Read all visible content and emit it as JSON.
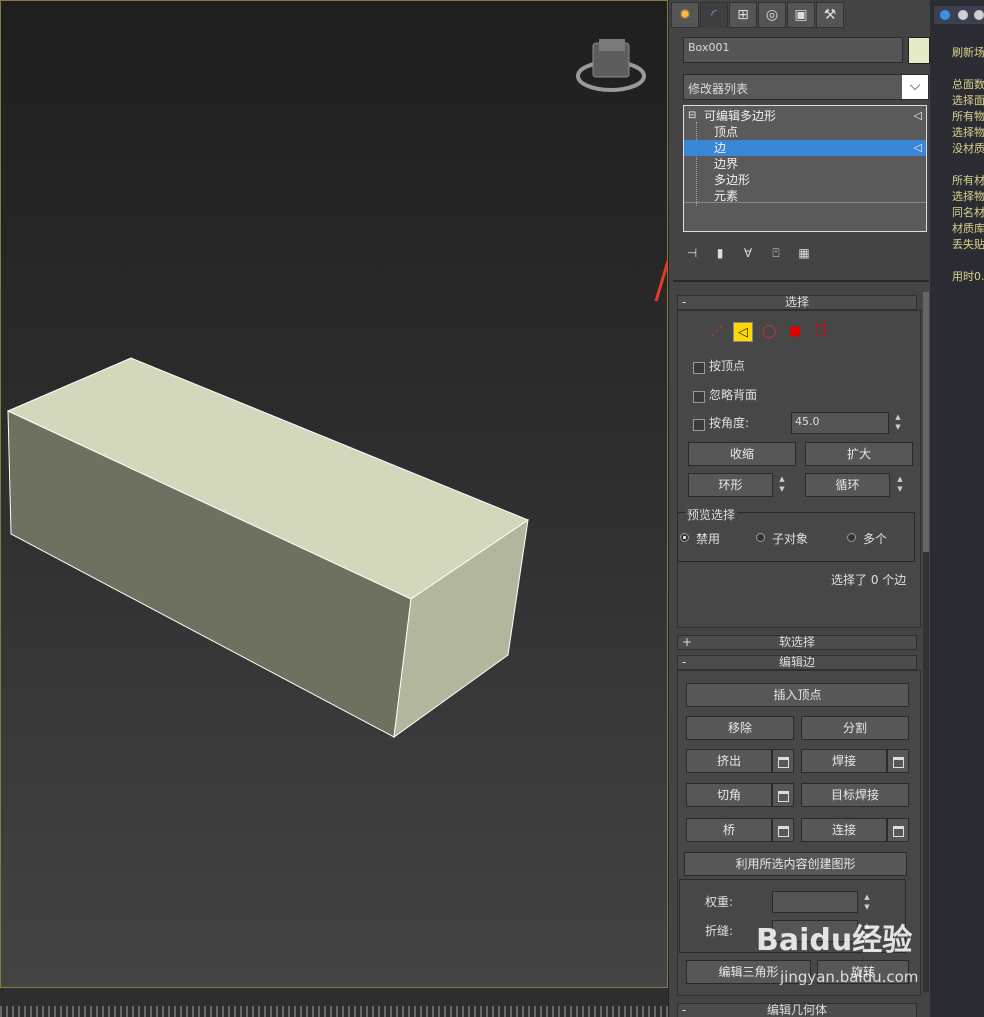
{
  "tabs": [
    "create-icon",
    "modify-icon",
    "hierarchy-icon",
    "motion-icon",
    "display-icon",
    "utilities-icon"
  ],
  "object_name": "Box001",
  "object_color": "#e6ecc9",
  "modifier_list": "修改器列表",
  "stack": {
    "root": "可编辑多边形",
    "items": [
      "顶点",
      "边",
      "边界",
      "多边形",
      "元素"
    ],
    "selected": "边"
  },
  "selection": {
    "title": "选择",
    "by_vertex": "按顶点",
    "ignore_backfacing": "忽略背面",
    "by_angle": "按角度:",
    "angle_value": "45.0",
    "shrink": "收缩",
    "grow": "扩大",
    "ring": "环形",
    "loop": "循环",
    "preview_title": "预览选择",
    "preview_off": "禁用",
    "preview_subobj": "子对象",
    "preview_multi": "多个",
    "status": "选择了 0 个边"
  },
  "soft_selection": "软选择",
  "edit_edges": {
    "title": "编辑边",
    "insert_vertex": "插入顶点",
    "remove": "移除",
    "split": "分割",
    "extrude": "挤出",
    "weld": "焊接",
    "chamfer": "切角",
    "target_weld": "目标焊接",
    "bridge": "桥",
    "connect": "连接",
    "create_shape": "利用所选内容创建图形",
    "weight": "权重:",
    "crease": "折缝:",
    "edit_tri": "编辑三角形",
    "turn": "旋转"
  },
  "edit_geometry": "编辑几何体",
  "listener_lines": [
    "刷新场",
    "总面数",
    "选择面",
    "所有物",
    "选择物",
    "没材质",
    "所有材",
    "选择物",
    "同名材",
    "材质库",
    "丢失贴",
    "用时0."
  ],
  "watermark": "Baidu经验",
  "watermark_sub": "jingyan.baidu.com"
}
